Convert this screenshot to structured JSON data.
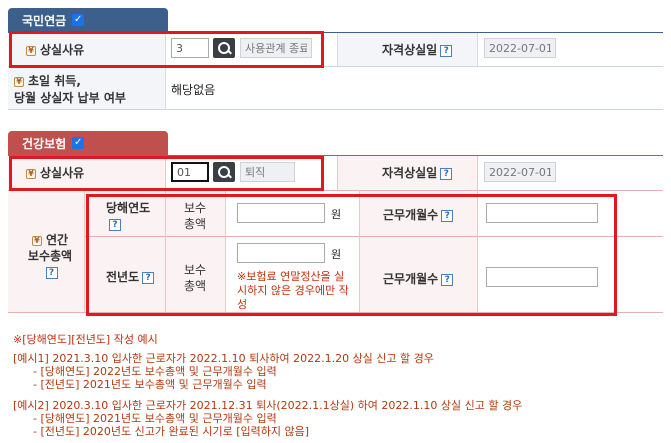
{
  "pension": {
    "title": "국민연금",
    "loss_reason_label": "상실사유",
    "loss_code": "3",
    "loss_reason_text": "사용관계 종료",
    "loss_date_label": "자격상실일",
    "loss_date": "2022-07-01",
    "first_acq_label_1": "초일 취득,",
    "first_acq_label_2": "당월 상실자 납부 여부",
    "first_acq_value": "해당없음"
  },
  "health": {
    "title": "건강보험",
    "loss_reason_label": "상실사유",
    "loss_code": "01",
    "loss_reason_text": "퇴직",
    "loss_date_label": "자격상실일",
    "loss_date": "2022-07-01",
    "annual_label_1": "연간",
    "annual_label_2": "보수총액",
    "current_year_label": "당해연도",
    "prev_year_label": "전년도",
    "pay_total_label_1": "보수",
    "pay_total_label_2": "총액",
    "won": "원",
    "months_label": "근무개월수",
    "note_line1": "※보험료 연말정산을 실",
    "note_line2": "시하지 않은 경우에만 작",
    "note_line3": "성"
  },
  "examples": {
    "heading": "※[당해연도][전년도] 작성 예시",
    "ex1_title": "[예시1] 2021.3.10 입사한 근로자가 2022.1.10 퇴사하여 2022.1.20 상실 신고 할 경우",
    "ex1_a": "- [당해연도] 2022년도 보수총액 및 근무개월수 입력",
    "ex1_b": "- [전년도] 2021년도 보수총액 및 근무개월수 입력",
    "ex2_title": "[예시2] 2020.3.10 입사한 근로자가 2021.12.31 퇴사(2022.1.1상실) 하여 2022.1.10 상실 신고 할 경우",
    "ex2_a": "- [당해연도] 2021년도 보수총액 및 근무개월수 입력",
    "ex2_b": "- [전년도] 2020년도 신고가 완료된 시기로 [입력하지 않음]"
  },
  "icons": {
    "help": "?",
    "required": "¥",
    "check": "✓"
  }
}
